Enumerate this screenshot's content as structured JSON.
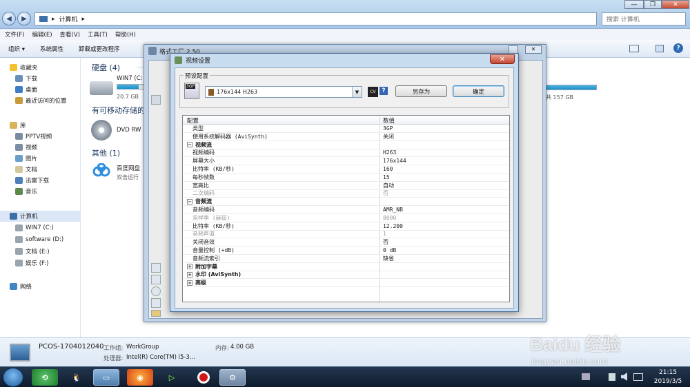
{
  "explorer": {
    "address_segment": "计算机",
    "search_placeholder": "搜索 计算机",
    "menu": [
      "文件(F)",
      "编辑(E)",
      "查看(V)",
      "工具(T)",
      "帮助(H)"
    ],
    "toolbar": [
      "组织 ▾",
      "系统属性",
      "卸载或更改程序"
    ],
    "sidebar": {
      "favorites": "收藏夹",
      "fav_items": [
        "下载",
        "桌面",
        "最近访问的位置"
      ],
      "libraries": "库",
      "lib_items": [
        "PPTV视频",
        "视频",
        "图片",
        "文档",
        "迅雷下载",
        "音乐"
      ],
      "computer": "计算机",
      "drives": [
        "WIN7 (C:)",
        "software (D:)",
        "文档 (E:)",
        "娱乐 (F:)"
      ],
      "network": "网络"
    },
    "groups": {
      "hdd": "硬盘 (4)",
      "removable": "有可移动存储的",
      "other": "其他 (1)"
    },
    "drive_c_name": "WIN7 (C:",
    "drive_c_free": "20.7 GB",
    "drive_c_fill": 0.82,
    "drive_right_free": "共 157 GB",
    "dvd_label": "DVD RW",
    "baidu_name": "百度网盘",
    "baidu_sub": "双击运行",
    "details": {
      "pc_name": "PCOS-1704012040",
      "workgroup_label": "工作组:",
      "workgroup": "WorkGroup",
      "memory_label": "内存:",
      "memory": "4.00 GB",
      "cpu_label": "处理器:",
      "cpu": "Intel(R) Core(TM) i5-3..."
    }
  },
  "taskbar": {
    "time": "21:15",
    "date": "2019/3/5"
  },
  "outer_app": {
    "title": "格式工厂 2.50"
  },
  "dialog": {
    "title": "视频设置",
    "preset_legend": "预设配置",
    "preset_value": "176x144 H263",
    "save_as": "另存为",
    "ok": "确定",
    "close": "✕",
    "help": "?",
    "badge": "3GP",
    "header_name": "配置",
    "header_value": "数值",
    "rows": [
      {
        "name": "类型",
        "value": "3GP"
      },
      {
        "name": "使用系统解码器 (AviSynth)",
        "value": "关闭"
      },
      {
        "name": "视频流",
        "value": "",
        "group": true,
        "expanded": true
      },
      {
        "name": "视频编码",
        "value": "H263"
      },
      {
        "name": "屏幕大小",
        "value": "176x144"
      },
      {
        "name": "比特率 (KB/秒)",
        "value": "160"
      },
      {
        "name": "每秒帧数",
        "value": "15"
      },
      {
        "name": "宽高比",
        "value": "自动"
      },
      {
        "name": "二次编码",
        "value": "否",
        "disabled": true
      },
      {
        "name": "音频流",
        "value": "",
        "group": true,
        "expanded": true
      },
      {
        "name": "音频编码",
        "value": "AMR_NB"
      },
      {
        "name": "采样率 (赫兹)",
        "value": "8000",
        "disabled": true
      },
      {
        "name": "比特率 (KB/秒)",
        "value": "12.200"
      },
      {
        "name": "音频声道",
        "value": "1",
        "disabled": true
      },
      {
        "name": "关闭音效",
        "value": "否"
      },
      {
        "name": "音量控制 (+dB)",
        "value": "0 dB"
      },
      {
        "name": "音频流索引",
        "value": "缺省"
      },
      {
        "name": "附加字幕",
        "value": "",
        "group": true,
        "expanded": false
      },
      {
        "name": "水印 (AviSynth)",
        "value": "",
        "group": true,
        "expanded": false
      },
      {
        "name": "高级",
        "value": "",
        "group": true,
        "expanded": false
      }
    ]
  },
  "watermark": {
    "brand": "Baidu 经验",
    "url": "jingyan.baidu.com"
  }
}
